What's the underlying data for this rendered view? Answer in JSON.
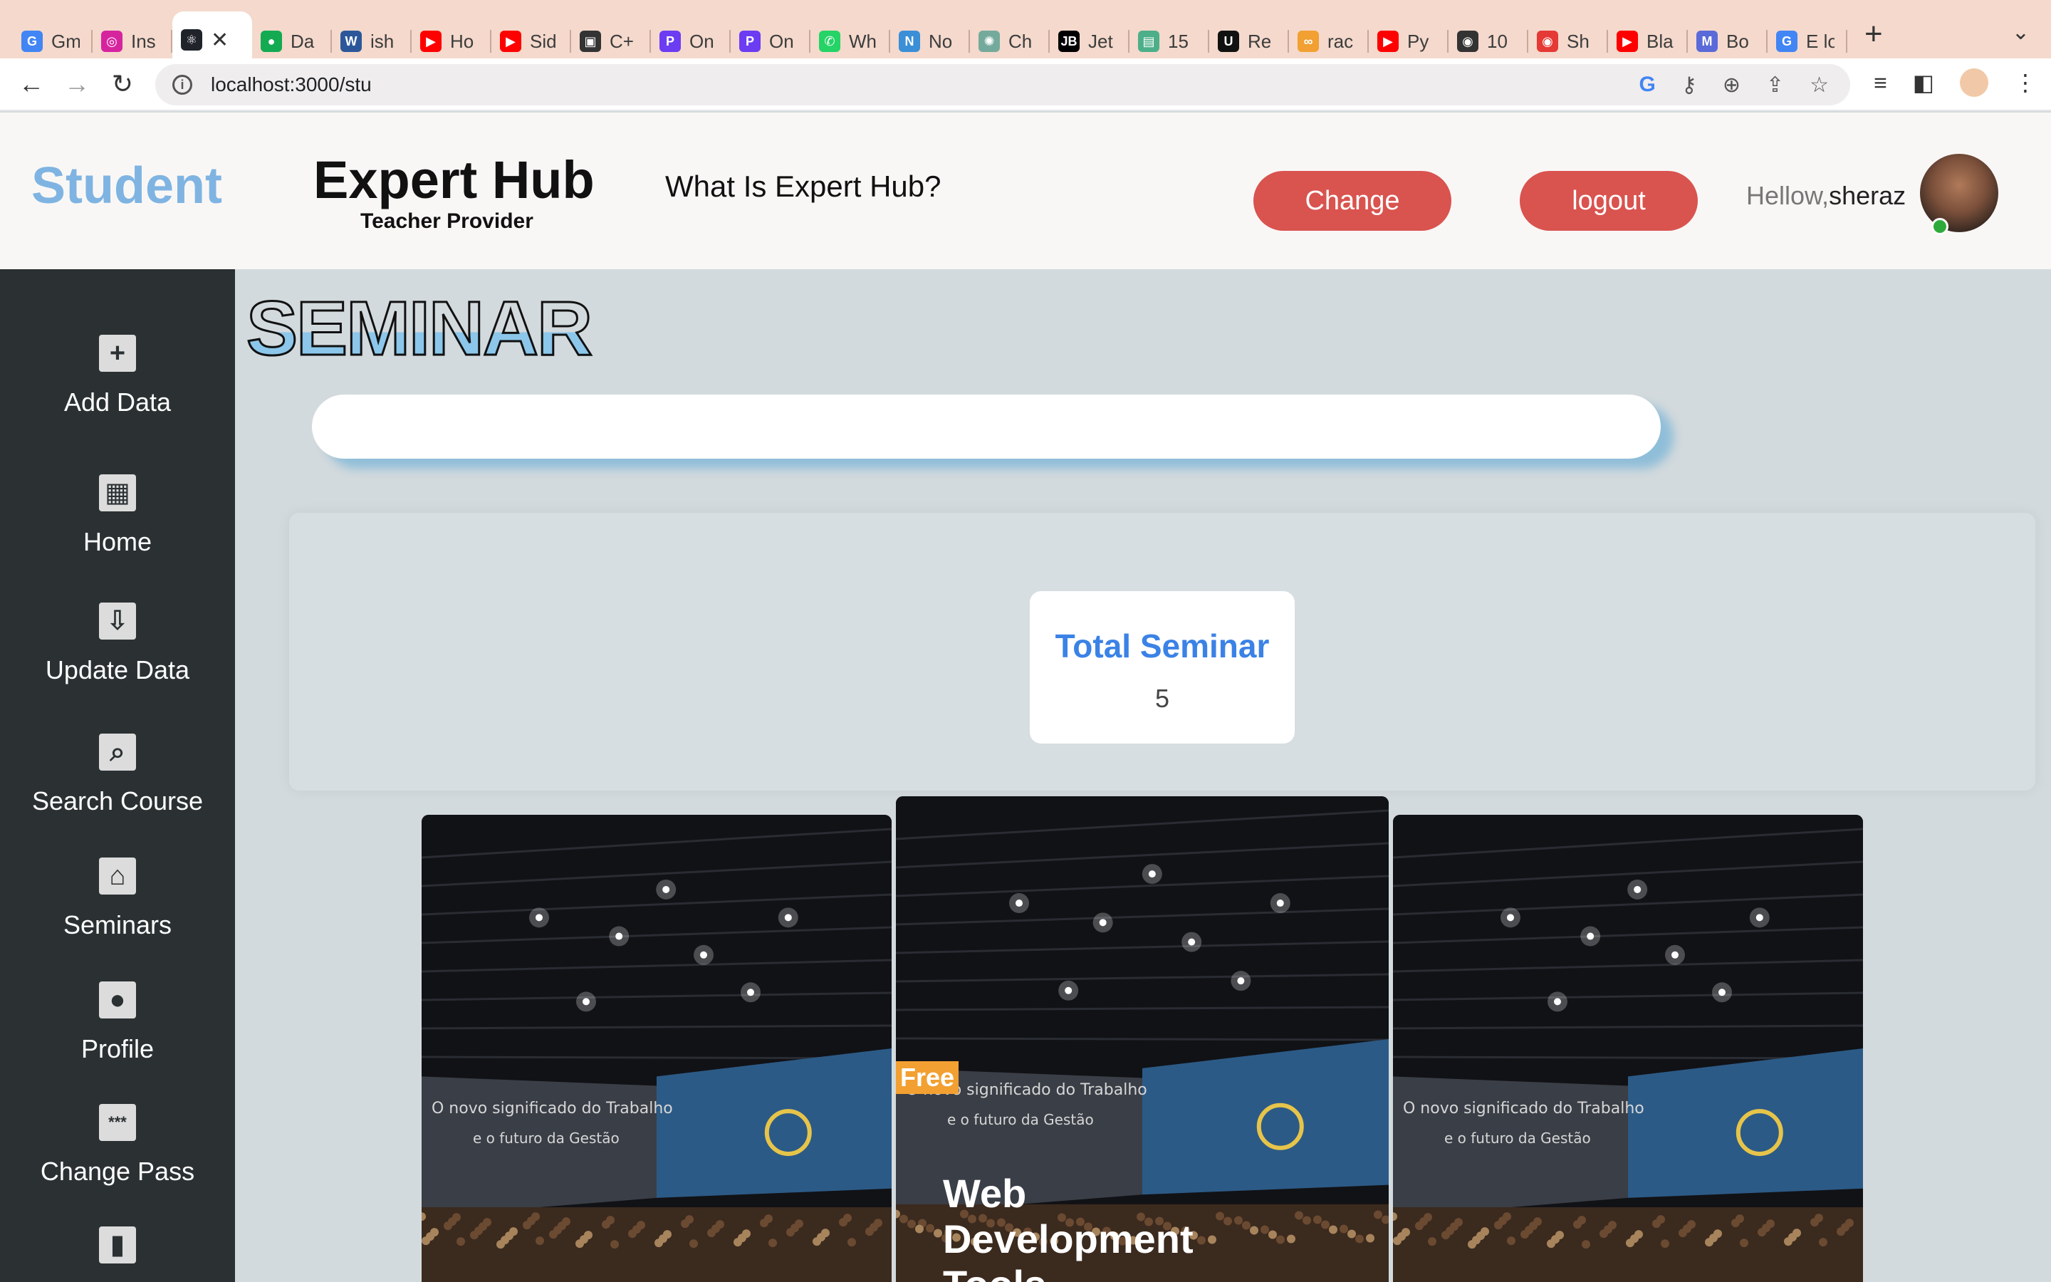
{
  "browser": {
    "tabs": [
      {
        "label": "Gm",
        "icon": "google-icon",
        "color": "#4285f4",
        "glyph": "G"
      },
      {
        "label": "Ins",
        "icon": "instagram-icon",
        "color": "#d6249f",
        "glyph": "◎"
      },
      {
        "label": "",
        "icon": "react-icon",
        "color": "#20232a",
        "glyph": "⚛",
        "active": true
      },
      {
        "label": "Da",
        "icon": "mongodb-icon",
        "color": "#13aa52",
        "glyph": "●"
      },
      {
        "label": "ish",
        "icon": "word-icon",
        "color": "#2b579a",
        "glyph": "W"
      },
      {
        "label": "Ho",
        "icon": "youtube-icon",
        "color": "#ff0000",
        "glyph": "▶"
      },
      {
        "label": "Sid",
        "icon": "youtube-icon",
        "color": "#ff0000",
        "glyph": "▶"
      },
      {
        "label": "C+",
        "icon": "window-icon",
        "color": "#333333",
        "glyph": "▣"
      },
      {
        "label": "On",
        "icon": "p-icon",
        "color": "#6b3cf2",
        "glyph": "P"
      },
      {
        "label": "On",
        "icon": "p-icon",
        "color": "#6b3cf2",
        "glyph": "P"
      },
      {
        "label": "Wh",
        "icon": "whatsapp-icon",
        "color": "#25d366",
        "glyph": "✆"
      },
      {
        "label": "No",
        "icon": "n-icon",
        "color": "#3a8fd6",
        "glyph": "N"
      },
      {
        "label": "Ch",
        "icon": "chatgpt-icon",
        "color": "#74aa9c",
        "glyph": "✺"
      },
      {
        "label": "Jet",
        "icon": "jetbrains-icon",
        "color": "#000000",
        "glyph": "JB"
      },
      {
        "label": "15",
        "icon": "sheet-icon",
        "color": "#4caf8a",
        "glyph": "▤"
      },
      {
        "label": "Re",
        "icon": "u-icon",
        "color": "#111111",
        "glyph": "U"
      },
      {
        "label": "rac",
        "icon": "infinity-icon",
        "color": "#f2a032",
        "glyph": "∞"
      },
      {
        "label": "Py",
        "icon": "youtube-icon",
        "color": "#ff0000",
        "glyph": "▶"
      },
      {
        "label": "10",
        "icon": "globe-icon",
        "color": "#333333",
        "glyph": "◉"
      },
      {
        "label": "Sh",
        "icon": "record-icon",
        "color": "#e53935",
        "glyph": "◉"
      },
      {
        "label": "Bla",
        "icon": "youtube-icon",
        "color": "#ff0000",
        "glyph": "▶"
      },
      {
        "label": "Bo",
        "icon": "mdb-icon",
        "color": "#5a6ad8",
        "glyph": "M"
      },
      {
        "label": "E lo",
        "icon": "google-icon",
        "color": "#4285f4",
        "glyph": "G"
      }
    ],
    "url": "localhost:3000/stu"
  },
  "header": {
    "brand": "Student",
    "logo_title": "Expert Hub",
    "logo_subtitle": "Teacher Provider",
    "nav_link": "What Is Expert Hub?",
    "change_button": "Change",
    "logout_button": "logout",
    "greeting": "Hellow,",
    "username": "sheraz"
  },
  "sidebar": {
    "items": [
      {
        "label": "Add Data",
        "icon": "add-box-icon",
        "glyph": "+"
      },
      {
        "label": "Home",
        "icon": "dashboard-icon",
        "glyph": "▦"
      },
      {
        "label": "Update Data",
        "icon": "download-phone-icon",
        "glyph": "⇩"
      },
      {
        "label": "Search Course",
        "icon": "search-zoom-icon",
        "glyph": "⌕"
      },
      {
        "label": "Seminars",
        "icon": "house-icon",
        "glyph": "⌂"
      },
      {
        "label": "Profile",
        "icon": "person-icon",
        "glyph": "●"
      },
      {
        "label": "Change Pass",
        "icon": "password-icon",
        "glyph": "***"
      },
      {
        "label": "",
        "icon": "book-icon",
        "glyph": "▮"
      }
    ]
  },
  "main": {
    "page_title": "SEMINAR",
    "search_placeholder": "",
    "stat": {
      "title": "Total Seminar",
      "value": "5"
    },
    "cards": [
      {
        "badge": "",
        "title": "",
        "screen_line1": "O novo significado do Trabalho",
        "screen_line2": "e o futuro da Gestão"
      },
      {
        "badge": "Free",
        "title": "Web Development Tools",
        "screen_line1": "O novo significado do Trabalho",
        "screen_line2": "e o futuro da Gestão"
      },
      {
        "badge": "",
        "title": "",
        "screen_line1": "O novo significado do Trabalho",
        "screen_line2": "e o futuro da Gestão"
      }
    ]
  },
  "colors": {
    "brand": "#7fb4e2",
    "accent_red": "#d9534f",
    "sidebar_bg": "#2b3133",
    "stat_title": "#3b82e6",
    "free_badge": "#f2a032"
  }
}
